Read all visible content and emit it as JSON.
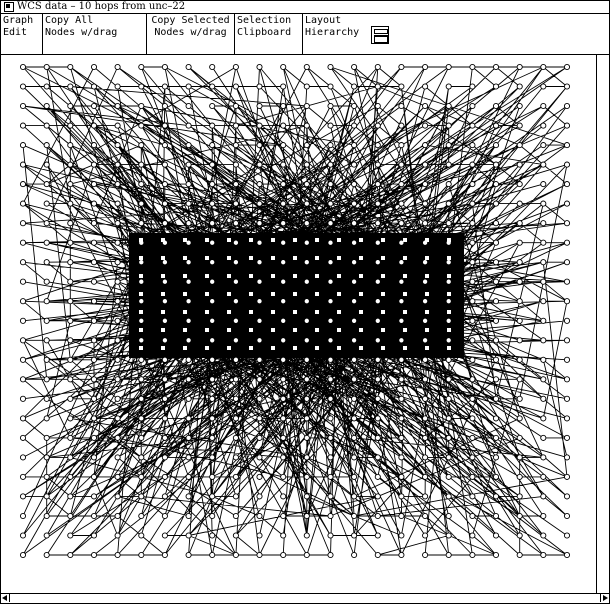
{
  "window": {
    "title": "WCS data – 10 hops from unc–22"
  },
  "toolbar": {
    "graph_edit": [
      "Graph",
      "Edit"
    ],
    "copy_all": [
      "Copy All",
      "Nodes w/drag"
    ],
    "copy_selected": [
      "Copy Selected",
      "Nodes w/drag"
    ],
    "selection_clipboard": [
      "Selection",
      "Clipboard"
    ],
    "layout_hierarchy": [
      "Layout",
      "Hierarchy"
    ],
    "icon": "layout-window-icon"
  },
  "graph": {
    "outer_grid": {
      "cols": 24,
      "rows": 26
    },
    "dense_grid": {
      "cols": 15,
      "rows": 7
    }
  },
  "colors": {
    "foreground": "#000000",
    "background": "#ffffff"
  }
}
